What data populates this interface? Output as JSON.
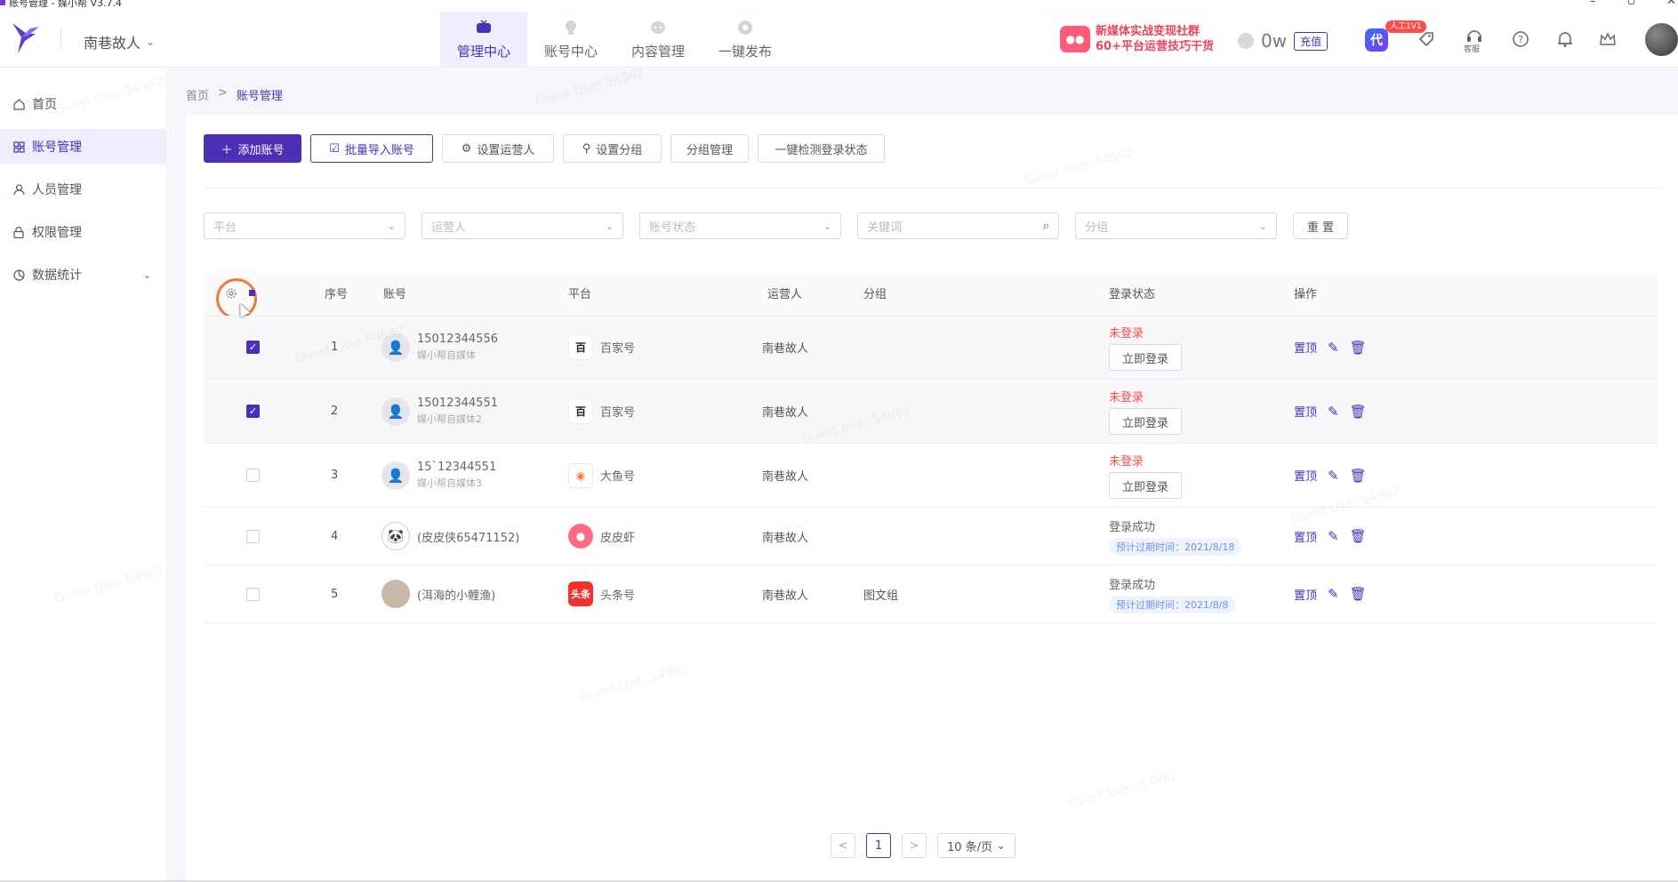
{
  "window": {
    "title": "账号管理 - 媒小帮 V3.7.4",
    "minimize": "–",
    "maximize": "▫",
    "close": "✕"
  },
  "header": {
    "user_name": "南巷故人",
    "nav": [
      {
        "label": "管理中心",
        "icon": "tv-icon",
        "active": true
      },
      {
        "label": "账号中心",
        "icon": "bulb-icon",
        "active": false
      },
      {
        "label": "内容管理",
        "icon": "chat-icon",
        "active": false
      },
      {
        "label": "一键发布",
        "icon": "rocket-icon",
        "active": false
      }
    ],
    "promo": {
      "line1": "新媒体实战变现社群",
      "line2": "60+平台运营技巧干货"
    },
    "coin_value": "0w",
    "recharge_label": "充值",
    "agent_badge": "人工1V1",
    "agent_glyph": "代",
    "service_label": "客服"
  },
  "sidebar": {
    "items": [
      {
        "label": "首页",
        "icon": "home-icon"
      },
      {
        "label": "账号管理",
        "icon": "grid-icon"
      },
      {
        "label": "人员管理",
        "icon": "person-icon"
      },
      {
        "label": "权限管理",
        "icon": "lock-icon"
      },
      {
        "label": "数据统计",
        "icon": "chart-icon"
      }
    ]
  },
  "breadcrumb": {
    "home": "首页",
    "sep": ">",
    "current": "账号管理"
  },
  "toolbar": {
    "add": "添加账号",
    "batch_import": "批量导入账号",
    "set_operator": "设置运营人",
    "set_group": "设置分组",
    "group_manage": "分组管理",
    "check_login": "一键检测登录状态"
  },
  "filters": {
    "platform": "平台",
    "operator": "运营人",
    "status": "账号状态",
    "keyword": "关键词",
    "group": "分组",
    "reset": "重 置"
  },
  "table": {
    "headers": {
      "index": "序号",
      "account": "账号",
      "platform": "平台",
      "operator": "运营人",
      "group": "分组",
      "login_status": "登录状态",
      "actions": "操作"
    },
    "rows": [
      {
        "index": "1",
        "checked": true,
        "name": "15012344556",
        "sub": "媒小帮自媒体",
        "platform": "百家号",
        "operator": "南巷故人",
        "group": "",
        "status": "未登录",
        "login_btn": "立即登录",
        "expire": "",
        "pin": "置顶"
      },
      {
        "index": "2",
        "checked": true,
        "name": "15012344551",
        "sub": "媒小帮自媒体2",
        "platform": "百家号",
        "operator": "南巷故人",
        "group": "",
        "status": "未登录",
        "login_btn": "立即登录",
        "expire": "",
        "pin": "置顶"
      },
      {
        "index": "3",
        "checked": false,
        "name": "15`12344551",
        "sub": "媒小帮自媒体3",
        "platform": "大鱼号",
        "operator": "南巷故人",
        "group": "",
        "status": "未登录",
        "login_btn": "立即登录",
        "expire": "",
        "pin": "置顶"
      },
      {
        "index": "4",
        "checked": false,
        "name": "(皮皮侠65471152)",
        "sub": "",
        "platform": "皮皮虾",
        "operator": "南巷故人",
        "group": "",
        "status": "登录成功",
        "login_btn": "",
        "expire": "预计过期时间：2021/8/18",
        "pin": "置顶"
      },
      {
        "index": "5",
        "checked": false,
        "name": "(洱海的小鲤渔)",
        "sub": "",
        "platform": "头条号",
        "operator": "南巷故人",
        "group": "图文组",
        "status": "登录成功",
        "login_btn": "",
        "expire": "预计过期时间：2021/8/8",
        "pin": "置顶"
      }
    ]
  },
  "pagination": {
    "prev": "<",
    "current": "1",
    "next": ">",
    "page_size": "10 条/页"
  },
  "watermark": "Guest User 54962",
  "colors": {
    "accent": "#4b2fb6",
    "danger": "#ff4d4f",
    "highlight_ring": "#f07a3a"
  }
}
